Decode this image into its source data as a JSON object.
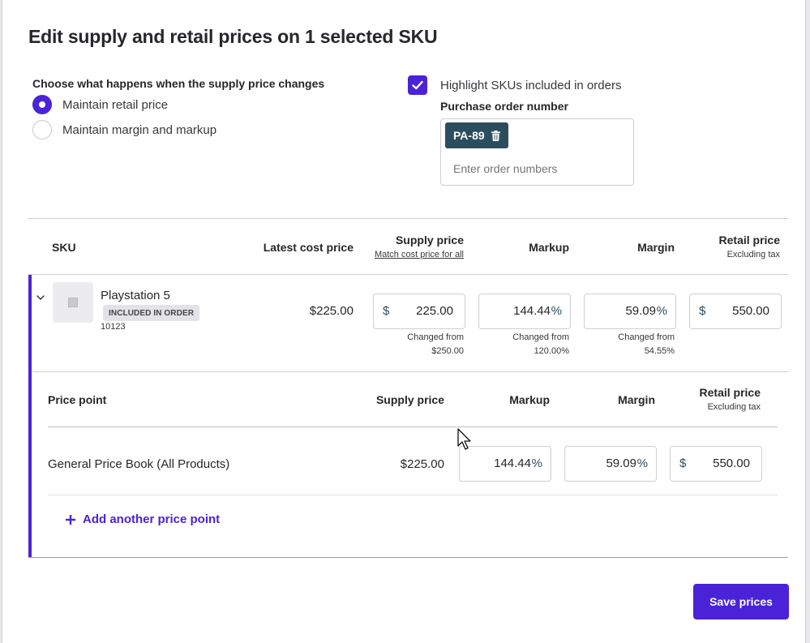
{
  "modal": {
    "title": "Edit supply and retail prices on 1 selected SKU"
  },
  "options": {
    "title": "Choose what happens when the supply price changes",
    "radios": [
      {
        "label": "Maintain retail price",
        "selected": true
      },
      {
        "label": "Maintain margin and markup",
        "selected": false
      }
    ]
  },
  "highlight": {
    "label": "Highlight SKUs included in orders",
    "checked": true
  },
  "purchase_order": {
    "label": "Purchase order number",
    "tag": "PA-89",
    "placeholder": "Enter order numbers"
  },
  "table": {
    "headers": {
      "sku": "SKU",
      "latest_cost": "Latest cost price",
      "supply": "Supply price",
      "supply_link": "Match cost price for all",
      "markup": "Markup",
      "margin": "Margin",
      "retail": "Retail price",
      "retail_sub": "Excluding tax"
    },
    "row": {
      "name": "Playstation 5",
      "badge": "INCLUDED IN ORDER",
      "sku_code": "10123",
      "latest_cost": "$225.00",
      "supply": {
        "prefix": "$",
        "value": "225.00",
        "changed_label": "Changed from",
        "changed_value": "$250.00"
      },
      "markup": {
        "value": "144.44",
        "suffix": "%",
        "changed_label": "Changed from",
        "changed_value": "120.00%"
      },
      "margin": {
        "value": "59.09",
        "suffix": "%",
        "changed_label": "Changed from",
        "changed_value": "54.55%"
      },
      "retail": {
        "prefix": "$",
        "value": "550.00"
      }
    }
  },
  "price_points": {
    "headers": {
      "name": "Price point",
      "supply": "Supply price",
      "markup": "Markup",
      "margin": "Margin",
      "retail": "Retail price",
      "retail_sub": "Excluding tax"
    },
    "rows": [
      {
        "name": "General Price Book (All Products)",
        "supply": "$225.00",
        "markup": {
          "value": "144.44",
          "suffix": "%"
        },
        "margin": {
          "value": "59.09",
          "suffix": "%"
        },
        "retail": {
          "prefix": "$",
          "value": "550.00"
        }
      }
    ],
    "add_label": "Add another price point"
  },
  "actions": {
    "save_label": "Save prices"
  },
  "colors": {
    "accent": "#4a23d8",
    "tag_bg": "#2b4e5e"
  }
}
